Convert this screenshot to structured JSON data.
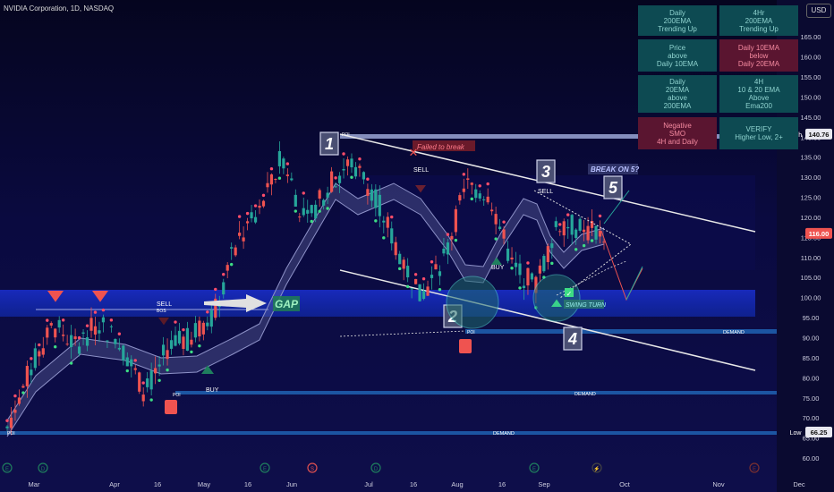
{
  "header": {
    "symbol": "NVIDIA Corporation, 1D, NASDAQ",
    "currency": "USD"
  },
  "table": {
    "cells": [
      {
        "text": "Daily\n200EMA\nTrending Up",
        "tone": "green"
      },
      {
        "text": "4Hr\n200EMA\nTrending Up",
        "tone": "green"
      },
      {
        "text": "Price\nabove\nDaily 10EMA",
        "tone": "green"
      },
      {
        "text": "Daily 10EMA\nbelow\nDaily 20EMA",
        "tone": "red"
      },
      {
        "text": "Daily\n20EMA\nabove\n200EMA",
        "tone": "green"
      },
      {
        "text": "4H\n10 & 20 EMA\nAbove\nEma200",
        "tone": "green"
      },
      {
        "text": "Negative\nSMO\n4H and Daily",
        "tone": "red"
      },
      {
        "text": "VERIFY\nHigher Low, 2+",
        "tone": "green"
      }
    ]
  },
  "price_labels": {
    "high": "High",
    "high_value": "140.76",
    "low": "Low",
    "low_value": "66.25",
    "last": "116.00"
  },
  "annotations": {
    "failed": "Failed to break",
    "break": "BREAK ON 5?",
    "sell1": "SELL",
    "bos": "BOS",
    "buy1": "BUY",
    "sell2": "SELL",
    "buy2": "BUY",
    "sell3": "SELL",
    "gap": "GAP",
    "swing": "SWING TURN",
    "demand": "DEMAND",
    "poi": "POI",
    "n1": "1",
    "n2": "2",
    "n3": "3",
    "n4": "4",
    "n5": "5"
  },
  "colors": {
    "bull": "#26a69a",
    "bear": "#ef5350",
    "accent": "#2962ff",
    "ema": "#2ecc71"
  },
  "chart_data": {
    "type": "candlestick",
    "title": "NVIDIA Corporation, 1D, NASDAQ",
    "xlabel": "",
    "ylabel": "",
    "x_ticks": [
      "Mar",
      "Apr",
      "16",
      "May",
      "16",
      "Jun",
      "Jul",
      "16",
      "Aug",
      "16",
      "Sep",
      "Oct",
      "Nov",
      "Dec"
    ],
    "y_ticks": [
      60,
      65,
      70,
      75,
      80,
      85,
      90,
      95,
      100,
      105,
      110,
      115,
      120,
      125,
      130,
      135,
      140,
      145,
      150,
      155,
      160,
      165
    ],
    "ylim": [
      58,
      168
    ],
    "key_levels": {
      "high": 140.76,
      "low": 66.25,
      "last": 116.0
    },
    "price_path": [
      {
        "date": "Feb 21",
        "close": 67.5
      },
      {
        "date": "Mar 1",
        "close": 82.0
      },
      {
        "date": "Mar 8",
        "close": 93.0
      },
      {
        "date": "Mar 15",
        "close": 88.0
      },
      {
        "date": "Mar 27",
        "close": 94.0
      },
      {
        "date": "Apr 8",
        "close": 88.0
      },
      {
        "date": "Apr 19",
        "close": 76.2
      },
      {
        "date": "Apr 26",
        "close": 87.5
      },
      {
        "date": "May 10",
        "close": 90.0
      },
      {
        "date": "May 22",
        "close": 96.0
      },
      {
        "date": "May 28",
        "close": 114.0
      },
      {
        "date": "Jun 7",
        "close": 121.0
      },
      {
        "date": "Jun 18",
        "close": 135.6
      },
      {
        "date": "Jun 24",
        "close": 118.0
      },
      {
        "date": "Jul 3",
        "close": 128.0
      },
      {
        "date": "Jul 10",
        "close": 134.0
      },
      {
        "date": "Jul 16",
        "close": 126.0
      },
      {
        "date": "Jul 25",
        "close": 112.0
      },
      {
        "date": "Aug 5",
        "close": 100.0
      },
      {
        "date": "Aug 12",
        "close": 109.0
      },
      {
        "date": "Aug 19",
        "close": 128.0
      },
      {
        "date": "Aug 27",
        "close": 126.0
      },
      {
        "date": "Sep 3",
        "close": 108.0
      },
      {
        "date": "Sep 6",
        "close": 102.8
      },
      {
        "date": "Sep 13",
        "close": 119.0
      },
      {
        "date": "Sep 19",
        "close": 117.0
      },
      {
        "date": "Sep 23",
        "close": 116.0
      }
    ]
  }
}
